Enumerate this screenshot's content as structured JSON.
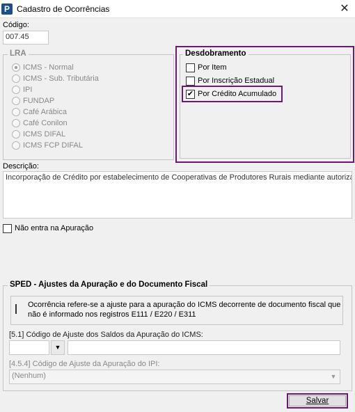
{
  "window": {
    "title": "Cadastro de Ocorrências",
    "close_glyph": "✕",
    "app_icon_letter": "P"
  },
  "codigo": {
    "label": "Código:",
    "value": "007.45"
  },
  "lra": {
    "legend": "LRA",
    "options": [
      "ICMS - Normal",
      "ICMS - Sub. Tributária",
      "IPI",
      "FUNDAP",
      "Café Arábica",
      "Café Conilon",
      "ICMS DIFAL",
      "ICMS FCP DIFAL"
    ],
    "selected": "ICMS - Normal"
  },
  "desdobramento": {
    "legend": "Desdobramento",
    "items": [
      {
        "label": "Por Item",
        "checked": false
      },
      {
        "label": "Por Inscrição Estadual",
        "checked": false
      },
      {
        "label": "Por Crédito Acumulado",
        "checked": true
      }
    ]
  },
  "descricao": {
    "label": "Descrição:",
    "value": "Incorporação de Crédito por estabelecimento de Cooperativas de Produtores Rurais mediante autorização"
  },
  "nao_entra": {
    "label": "Não entra na Apuração",
    "checked": false
  },
  "sped": {
    "legend": "SPED - Ajustes da Apuração e do Documento Fiscal",
    "ocorrencia_line1": "Ocorrência refere-se a ajuste para a apuração do ICMS decorrente de documento fiscal que",
    "ocorrencia_line2": "não é informado nos registros E111 / E220 / E311",
    "codigo_ajuste_label": "[5.1] Código de Ajuste dos Saldos da Apuração do ICMS:",
    "codigo_ajuste_value": "",
    "codigo_ajuste_desc": "",
    "ipi_label": "[4.5.4] Código de Ajuste da Apuração do IPI:",
    "ipi_value": "(Nenhum)"
  },
  "buttons": {
    "save_label": "Salvar"
  },
  "colors": {
    "highlight": "#6a1a72",
    "app_icon": "#1b4f8a"
  }
}
